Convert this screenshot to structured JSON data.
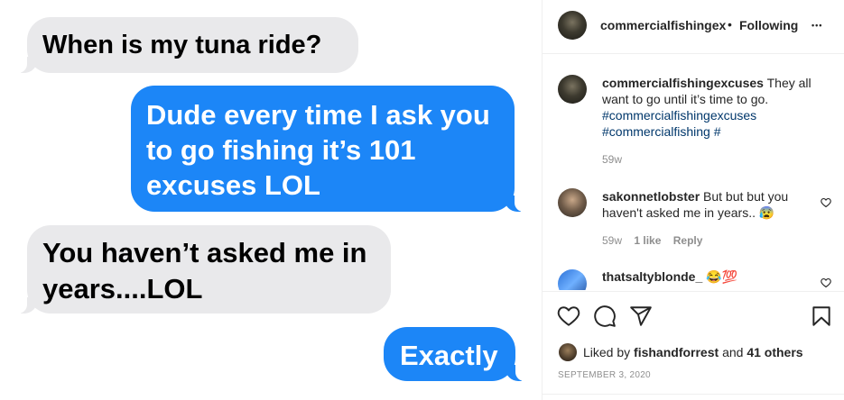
{
  "messages": [
    {
      "side": "left",
      "text": "When is my tuna ride?"
    },
    {
      "side": "right",
      "text": "Dude every time I ask you to go fishing it’s 101 excuses LOL"
    },
    {
      "side": "left",
      "text": "You haven’t asked me in years....LOL"
    },
    {
      "side": "right",
      "text": "Exactly"
    }
  ],
  "header": {
    "username": "commercialfishingex",
    "separator": "•",
    "follow_label": "Following",
    "more_label": "•••"
  },
  "caption": {
    "username": "commercialfishingexcuses",
    "text": "They all want to go until it’s time to go.",
    "hashtag1": "#commercialfishingexcuses",
    "hashtag2": "#commercialfishing",
    "hashtag3": "#",
    "time": "59w"
  },
  "comments": [
    {
      "username": "sakonnetlobster",
      "text": "But but but you haven't asked me in years.. 😰",
      "time": "59w",
      "likes": "1 like",
      "reply_label": "Reply"
    },
    {
      "username": "thatsaltyblonde_",
      "text": "😂💯"
    }
  ],
  "likes": {
    "prefix": "Liked by",
    "user": "fishandforrest",
    "and": "and",
    "others": "41 others"
  },
  "date": "SEPTEMBER 3, 2020",
  "colors": {
    "imessage_blue": "#1c86f7",
    "imessage_gray": "#e9e9eb",
    "ig_text": "#262626",
    "ig_link": "#00376b",
    "ig_meta": "#8e8e8e"
  }
}
